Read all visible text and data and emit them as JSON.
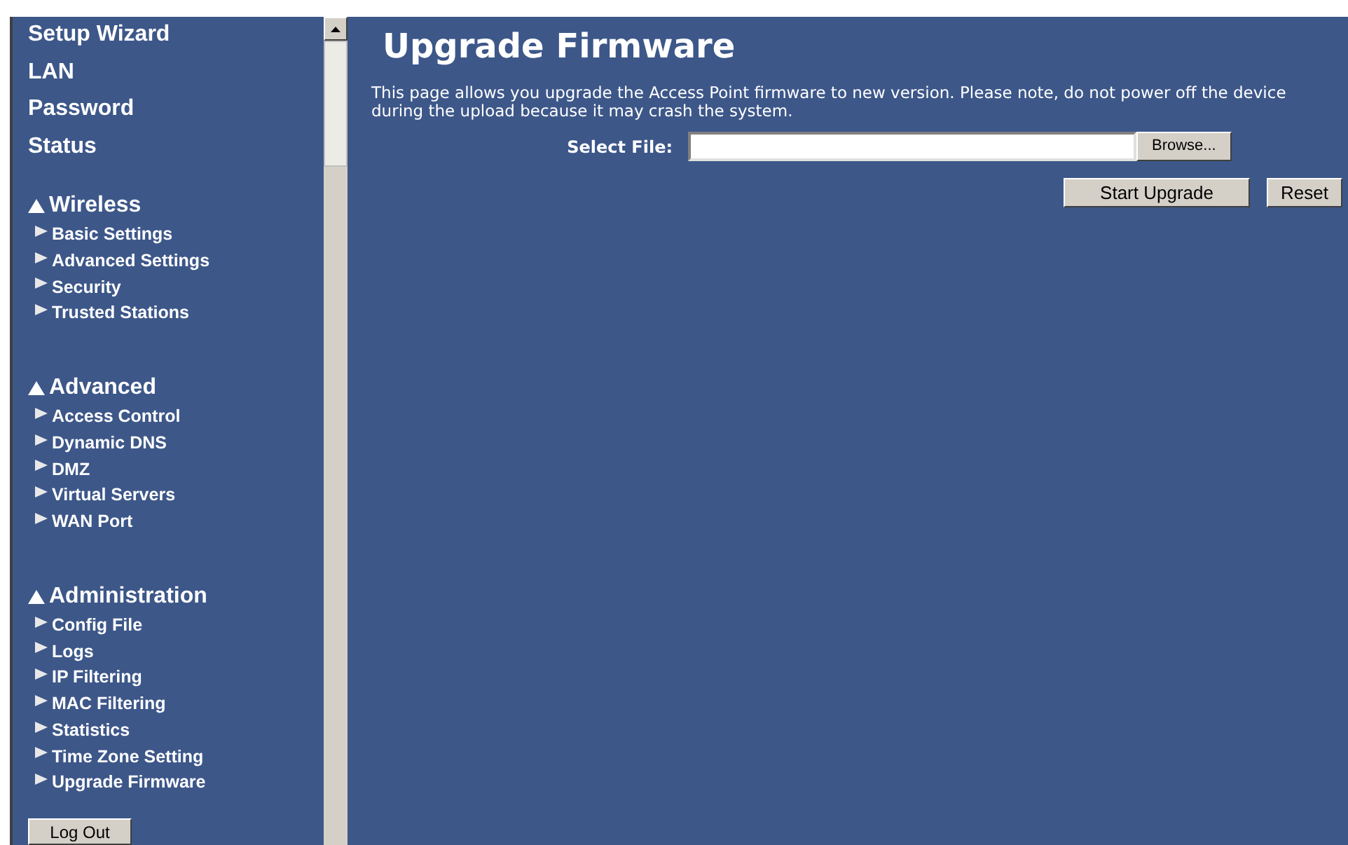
{
  "sidebar": {
    "links": [
      "Setup Wizard",
      "LAN",
      "Password",
      "Status"
    ],
    "sections": [
      {
        "title": "Wireless",
        "expanded": true,
        "items": [
          "Basic Settings",
          "Advanced Settings",
          "Security",
          "Trusted Stations"
        ]
      },
      {
        "title": "Advanced",
        "expanded": true,
        "items": [
          "Access Control",
          "Dynamic DNS",
          "DMZ",
          "Virtual Servers",
          "WAN Port"
        ]
      },
      {
        "title": "Administration",
        "expanded": true,
        "items": [
          "Config File",
          "Logs",
          "IP Filtering",
          "MAC Filtering",
          "Statistics",
          "Time Zone Setting",
          "Upgrade Firmware"
        ]
      }
    ],
    "logout_button": "Log Out"
  },
  "main": {
    "title": "Upgrade Firmware",
    "description": "This page allows you upgrade the Access Point firmware to new version. Please note, do not power off the device during the upload because it may crash the system.",
    "select_file_label": "Select File:",
    "browse_button": "Browse...",
    "start_button": "Start Upgrade",
    "reset_button": "Reset"
  }
}
